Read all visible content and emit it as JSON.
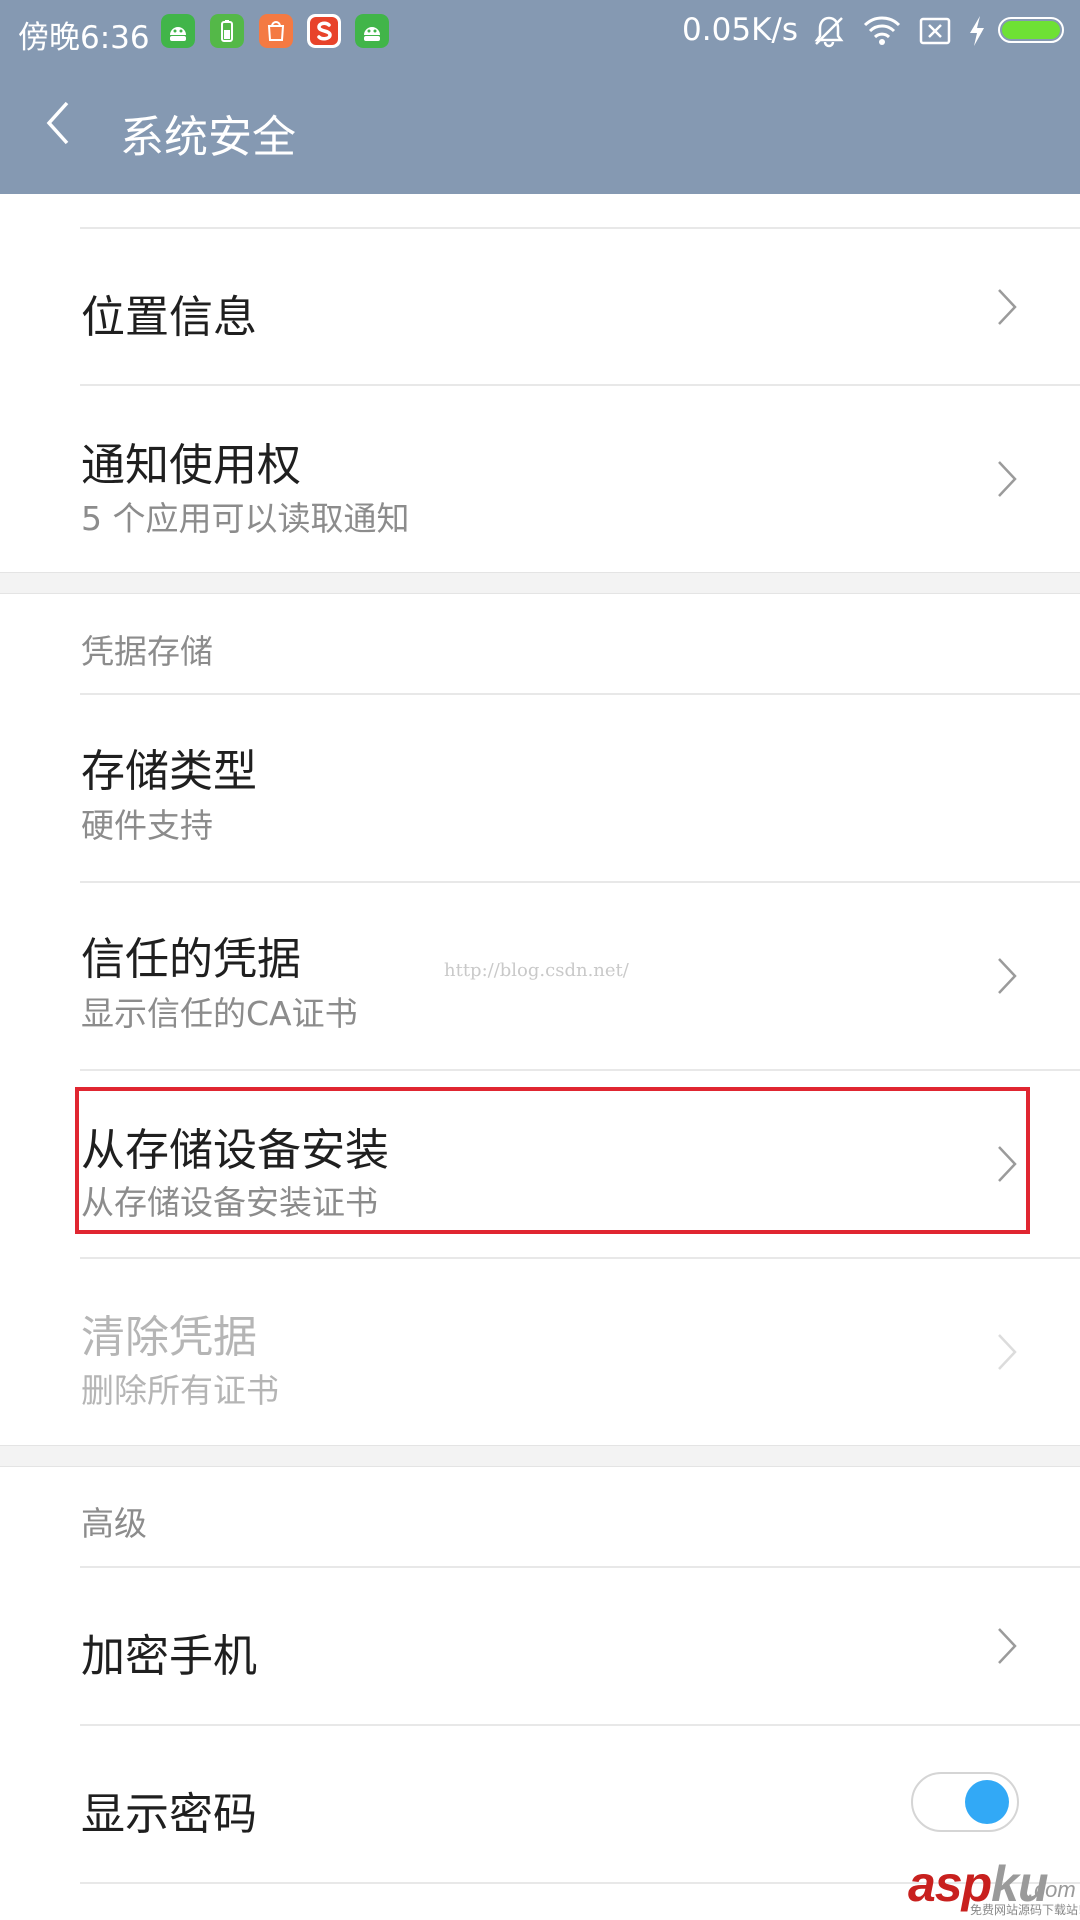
{
  "status_bar": {
    "time": "傍晚6:36",
    "network_speed": "0.05K/s",
    "app_icons": [
      "android-robot-icon",
      "battery-saver-icon",
      "mi-store-icon",
      "sogou-input-icon",
      "android-robot-icon"
    ],
    "system_icons": [
      "bell-muted-icon",
      "wifi-icon",
      "no-sim-icon",
      "charging-bolt-icon",
      "battery-icon"
    ],
    "battery_level": 1.0,
    "battery_color": "#6ee134"
  },
  "title_bar": {
    "title": "系统安全",
    "color": "#8599b2"
  },
  "items": {
    "location": {
      "title": "位置信息"
    },
    "notification_access": {
      "title": "通知使用权",
      "subtitle": "5 个应用可以读取通知"
    },
    "storage_type": {
      "title": "存储类型",
      "subtitle": "硬件支持"
    },
    "trusted_credentials": {
      "title": "信任的凭据",
      "subtitle": "显示信任的CA证书"
    },
    "install_from_storage": {
      "title": "从存储设备安装",
      "subtitle": "从存储设备安装证书",
      "highlight_color": "#e02631"
    },
    "clear_credentials": {
      "title": "清除凭据",
      "subtitle": "删除所有证书",
      "enabled": false
    },
    "encrypt_phone": {
      "title": "加密手机"
    },
    "show_password": {
      "title": "显示密码",
      "enabled": true,
      "toggle_color": "#32a9f6"
    }
  },
  "sections": {
    "credential_storage": "凭据存储",
    "advanced": "高级"
  },
  "watermark": "http://blog.csdn.net/",
  "logo": {
    "brand_asp": "asp",
    "brand_ku": "ku",
    "domain": ".com",
    "tagline": "免费网站源码下载站!"
  }
}
